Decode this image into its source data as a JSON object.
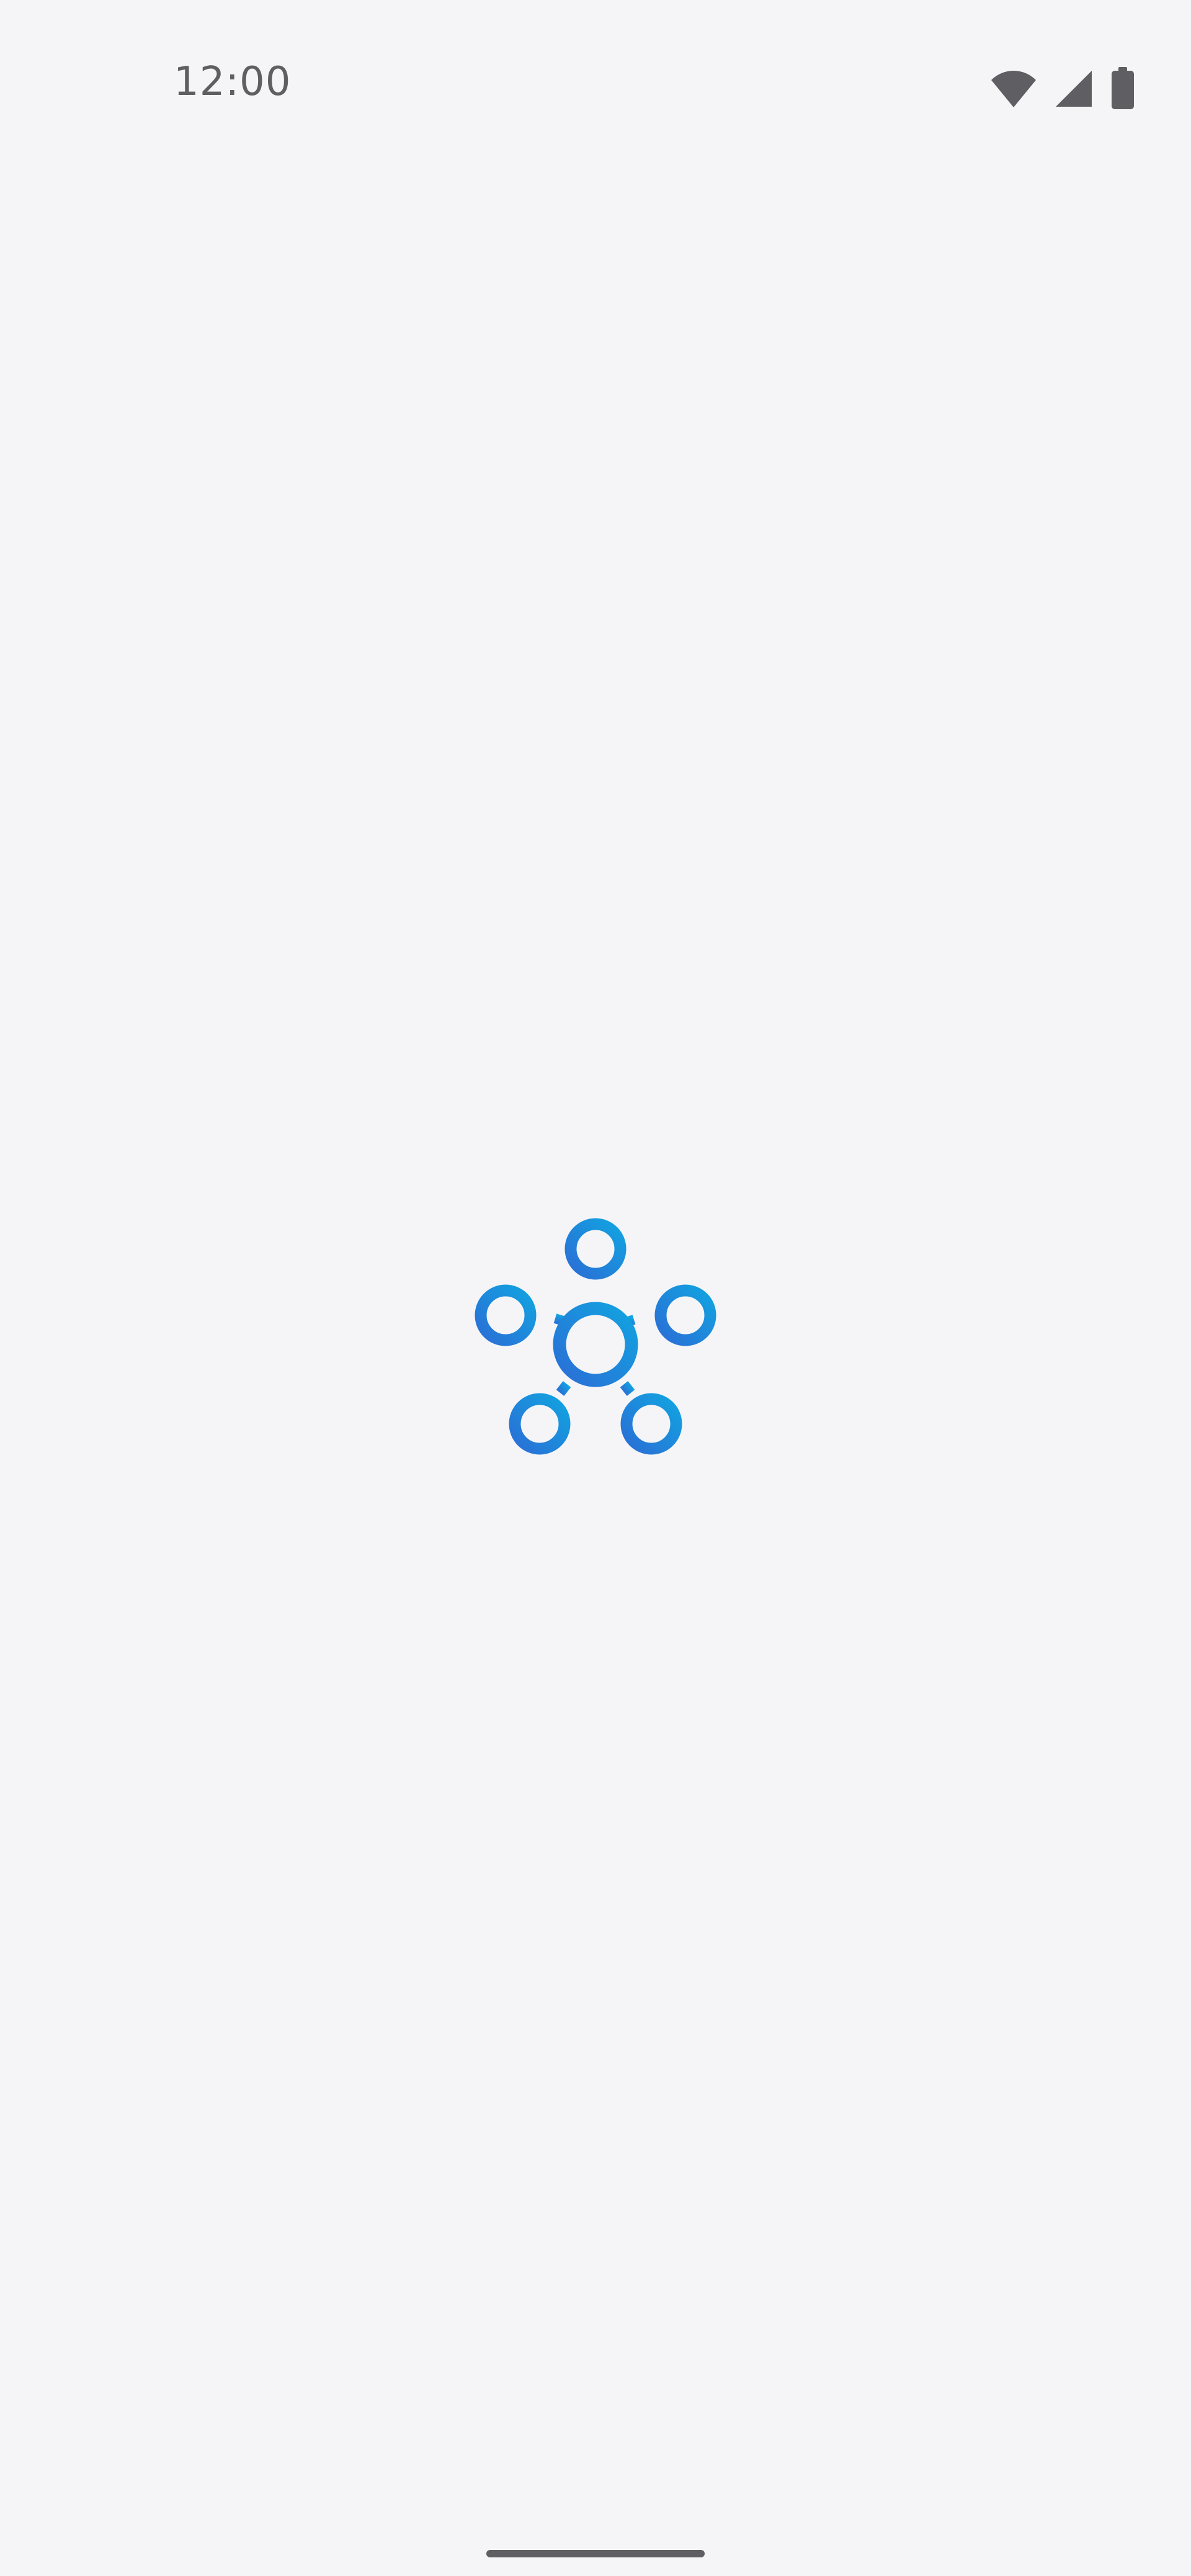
{
  "status_bar": {
    "time": "12:00",
    "icons": [
      "wifi-icon",
      "cellular-signal-icon",
      "battery-icon"
    ],
    "icon_color": "#5f5f63"
  },
  "splash": {
    "logo": "network-nodes-logo-icon",
    "logo_colors": [
      "#1fa0e0",
      "#2a6fd6"
    ]
  },
  "background_color": "#f5f5f8"
}
